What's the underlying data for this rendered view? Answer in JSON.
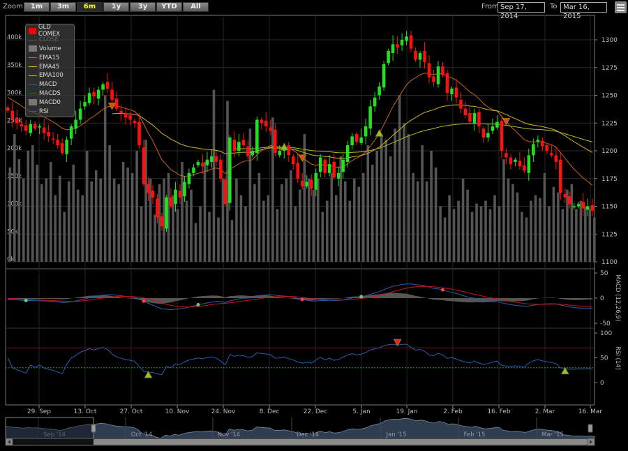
{
  "toolbar": {
    "zoom_label": "Zoom",
    "buttons": [
      "1m",
      "3m",
      "6m",
      "1y",
      "3y",
      "YTD",
      "All"
    ],
    "active": "6m",
    "from_label": "From",
    "from_value": "Sep 17, 2014",
    "to_label": "To",
    "to_value": "Mar 16, 2015",
    "menu_icon": "hamburger-icon"
  },
  "legend": [
    {
      "label": "GLD COMEX",
      "color": "#ff0000",
      "type": "box"
    },
    {
      "label": "CLOSE",
      "color": "#555555",
      "type": "line",
      "hidden": true
    },
    {
      "label": "Volume",
      "color": "#777777",
      "type": "box"
    },
    {
      "label": "EMA15",
      "color": "#c8641e",
      "type": "line"
    },
    {
      "label": "EMA45",
      "color": "#d2b428",
      "type": "line"
    },
    {
      "label": "EMA100",
      "color": "#b4be28",
      "type": "line"
    },
    {
      "label": "MACD",
      "color": "#2a5db0",
      "type": "line"
    },
    {
      "label": "MACDS",
      "color": "#c01818",
      "type": "line"
    },
    {
      "label": "MACD0",
      "color": "#777777",
      "type": "box"
    },
    {
      "label": "RSI",
      "color": "#2a5db0",
      "type": "line"
    }
  ],
  "chart_data": {
    "type": "candlestick",
    "price_axis": {
      "ticks": [
        1100,
        1125,
        1150,
        1175,
        1200,
        1225,
        1250,
        1275,
        1300
      ],
      "range": [
        1100,
        1300
      ]
    },
    "volume_axis": {
      "ticks": [
        "0k",
        "50k",
        "100k",
        "150k",
        "200k",
        "250k",
        "300k",
        "350k",
        "400k"
      ],
      "range": [
        0,
        400000
      ]
    },
    "x_ticks": [
      "29. Sep",
      "13. Oct",
      "27. Oct",
      "10. Nov",
      "24. Nov",
      "8. Dec",
      "22. Dec",
      "5. Jan",
      "19. Jan",
      "2. Feb",
      "16. Feb",
      "2. Mar",
      "16. Mar"
    ],
    "close": [
      1236,
      1228,
      1225,
      1222,
      1218,
      1224,
      1220,
      1222,
      1216,
      1213,
      1210,
      1205,
      1198,
      1210,
      1222,
      1228,
      1238,
      1244,
      1252,
      1249,
      1255,
      1260,
      1256,
      1246,
      1238,
      1234,
      1230,
      1228,
      1225,
      1205,
      1170,
      1162,
      1158,
      1140,
      1132,
      1158,
      1150,
      1165,
      1158,
      1172,
      1180,
      1185,
      1190,
      1186,
      1192,
      1195,
      1190,
      1175,
      1152,
      1212,
      1200,
      1208,
      1205,
      1195,
      1200,
      1228,
      1225,
      1222,
      1218,
      1198,
      1200,
      1203,
      1196,
      1188,
      1175,
      1168,
      1172,
      1166,
      1180,
      1194,
      1180,
      1188,
      1176,
      1180,
      1192,
      1205,
      1213,
      1208,
      1212,
      1222,
      1240,
      1248,
      1258,
      1278,
      1290,
      1296,
      1293,
      1300,
      1303,
      1292,
      1282,
      1288,
      1280,
      1266,
      1262,
      1276,
      1268,
      1252,
      1256,
      1248,
      1238,
      1232,
      1226,
      1234,
      1222,
      1212,
      1216,
      1222,
      1226,
      1200,
      1194,
      1188,
      1192,
      1186,
      1182,
      1196,
      1206,
      1210,
      1204,
      1200,
      1196,
      1190,
      1162,
      1158,
      1152,
      1150,
      1152,
      1148,
      1150,
      1146
    ],
    "volume": [
      170000,
      230000,
      185000,
      150000,
      200000,
      210000,
      175000,
      140000,
      150000,
      180000,
      120000,
      155000,
      90000,
      145000,
      175000,
      130000,
      120000,
      200000,
      145000,
      165000,
      150000,
      300000,
      210000,
      150000,
      140000,
      180000,
      170000,
      160000,
      200000,
      100000,
      220000,
      150000,
      85000,
      140000,
      150000,
      160000,
      120000,
      95000,
      180000,
      110000,
      130000,
      70000,
      100000,
      180000,
      90000,
      310000,
      80000,
      150000,
      290000,
      75000,
      150000,
      120000,
      100000,
      240000,
      140000,
      160000,
      110000,
      120000,
      260000,
      95000,
      140000,
      150000,
      165000,
      100000,
      130000,
      230000,
      150000,
      130000,
      150000,
      90000,
      110000,
      160000,
      120000,
      190000,
      145000,
      110000,
      150000,
      135000,
      160000,
      210000,
      175000,
      200000,
      230000,
      220000,
      190000,
      240000,
      300000,
      250000,
      230000,
      160000,
      145000,
      210000,
      145000,
      200000,
      170000,
      100000,
      80000,
      120000,
      95000,
      110000,
      150000,
      130000,
      90000,
      105000,
      100000,
      110000,
      95000,
      120000,
      100000,
      185000,
      150000,
      140000,
      125000,
      90000,
      80000,
      110000,
      120000,
      115000,
      160000,
      100000,
      135000,
      125000,
      95000,
      130000,
      140000,
      95000,
      110000,
      100000,
      95000,
      80000
    ],
    "signals": {
      "ema_up": [
        61,
        82
      ],
      "ema_down": [
        23,
        65,
        110
      ],
      "macd_up": [
        4,
        42,
        78
      ],
      "macd_down": [
        30,
        65,
        96
      ],
      "rsi_up": [
        31,
        123
      ],
      "rsi_down": [
        86
      ]
    },
    "macd": {
      "label": "MACD (12,26,9)",
      "ticks": [
        -50,
        0,
        50
      ],
      "range": [
        -50,
        50
      ]
    },
    "rsi": {
      "label": "RSI (14)",
      "ticks": [
        0,
        50,
        100
      ],
      "range": [
        0,
        100
      ],
      "overbought": 70,
      "oversold": 30
    }
  },
  "navigator": {
    "labels": [
      "Sep '14",
      "Oct '14",
      "Nov '14",
      "Dec '14",
      "Jan '15",
      "Feb '15",
      "Mar '15"
    ]
  }
}
